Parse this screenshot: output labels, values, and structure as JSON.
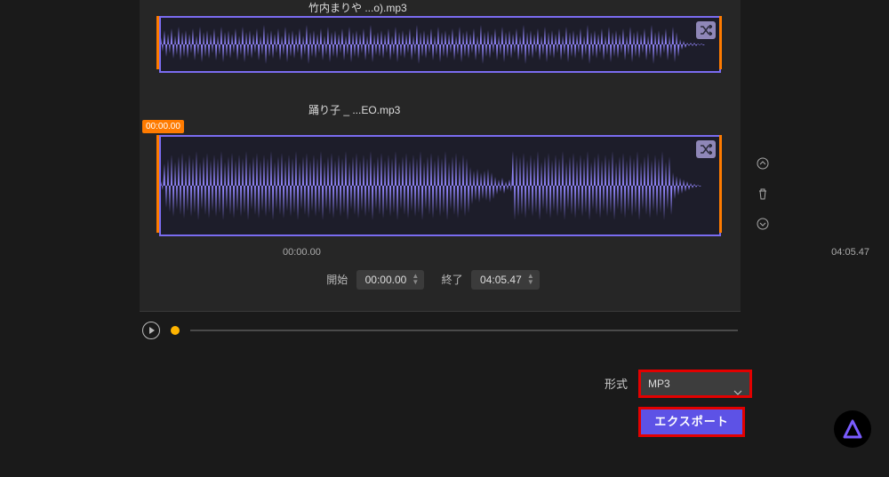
{
  "clip1": {
    "name": "竹内まりや ...o).mp3"
  },
  "clip2": {
    "name": "踊り子 _ ...EO.mp3",
    "tag": "00:00.00",
    "startTime": "00:00.00",
    "endTime": "04:05.47"
  },
  "range": {
    "startLabel": "開始",
    "startVal": "00:00.00",
    "endLabel": "終了",
    "endVal": "04:05.47"
  },
  "format": {
    "label": "形式",
    "value": "MP3"
  },
  "export": {
    "label": "エクスポート"
  },
  "icons": {
    "shuffle": "shuffle",
    "up": "collapse",
    "trash": "delete",
    "down": "expand",
    "play": "play",
    "chev": "⌄"
  }
}
